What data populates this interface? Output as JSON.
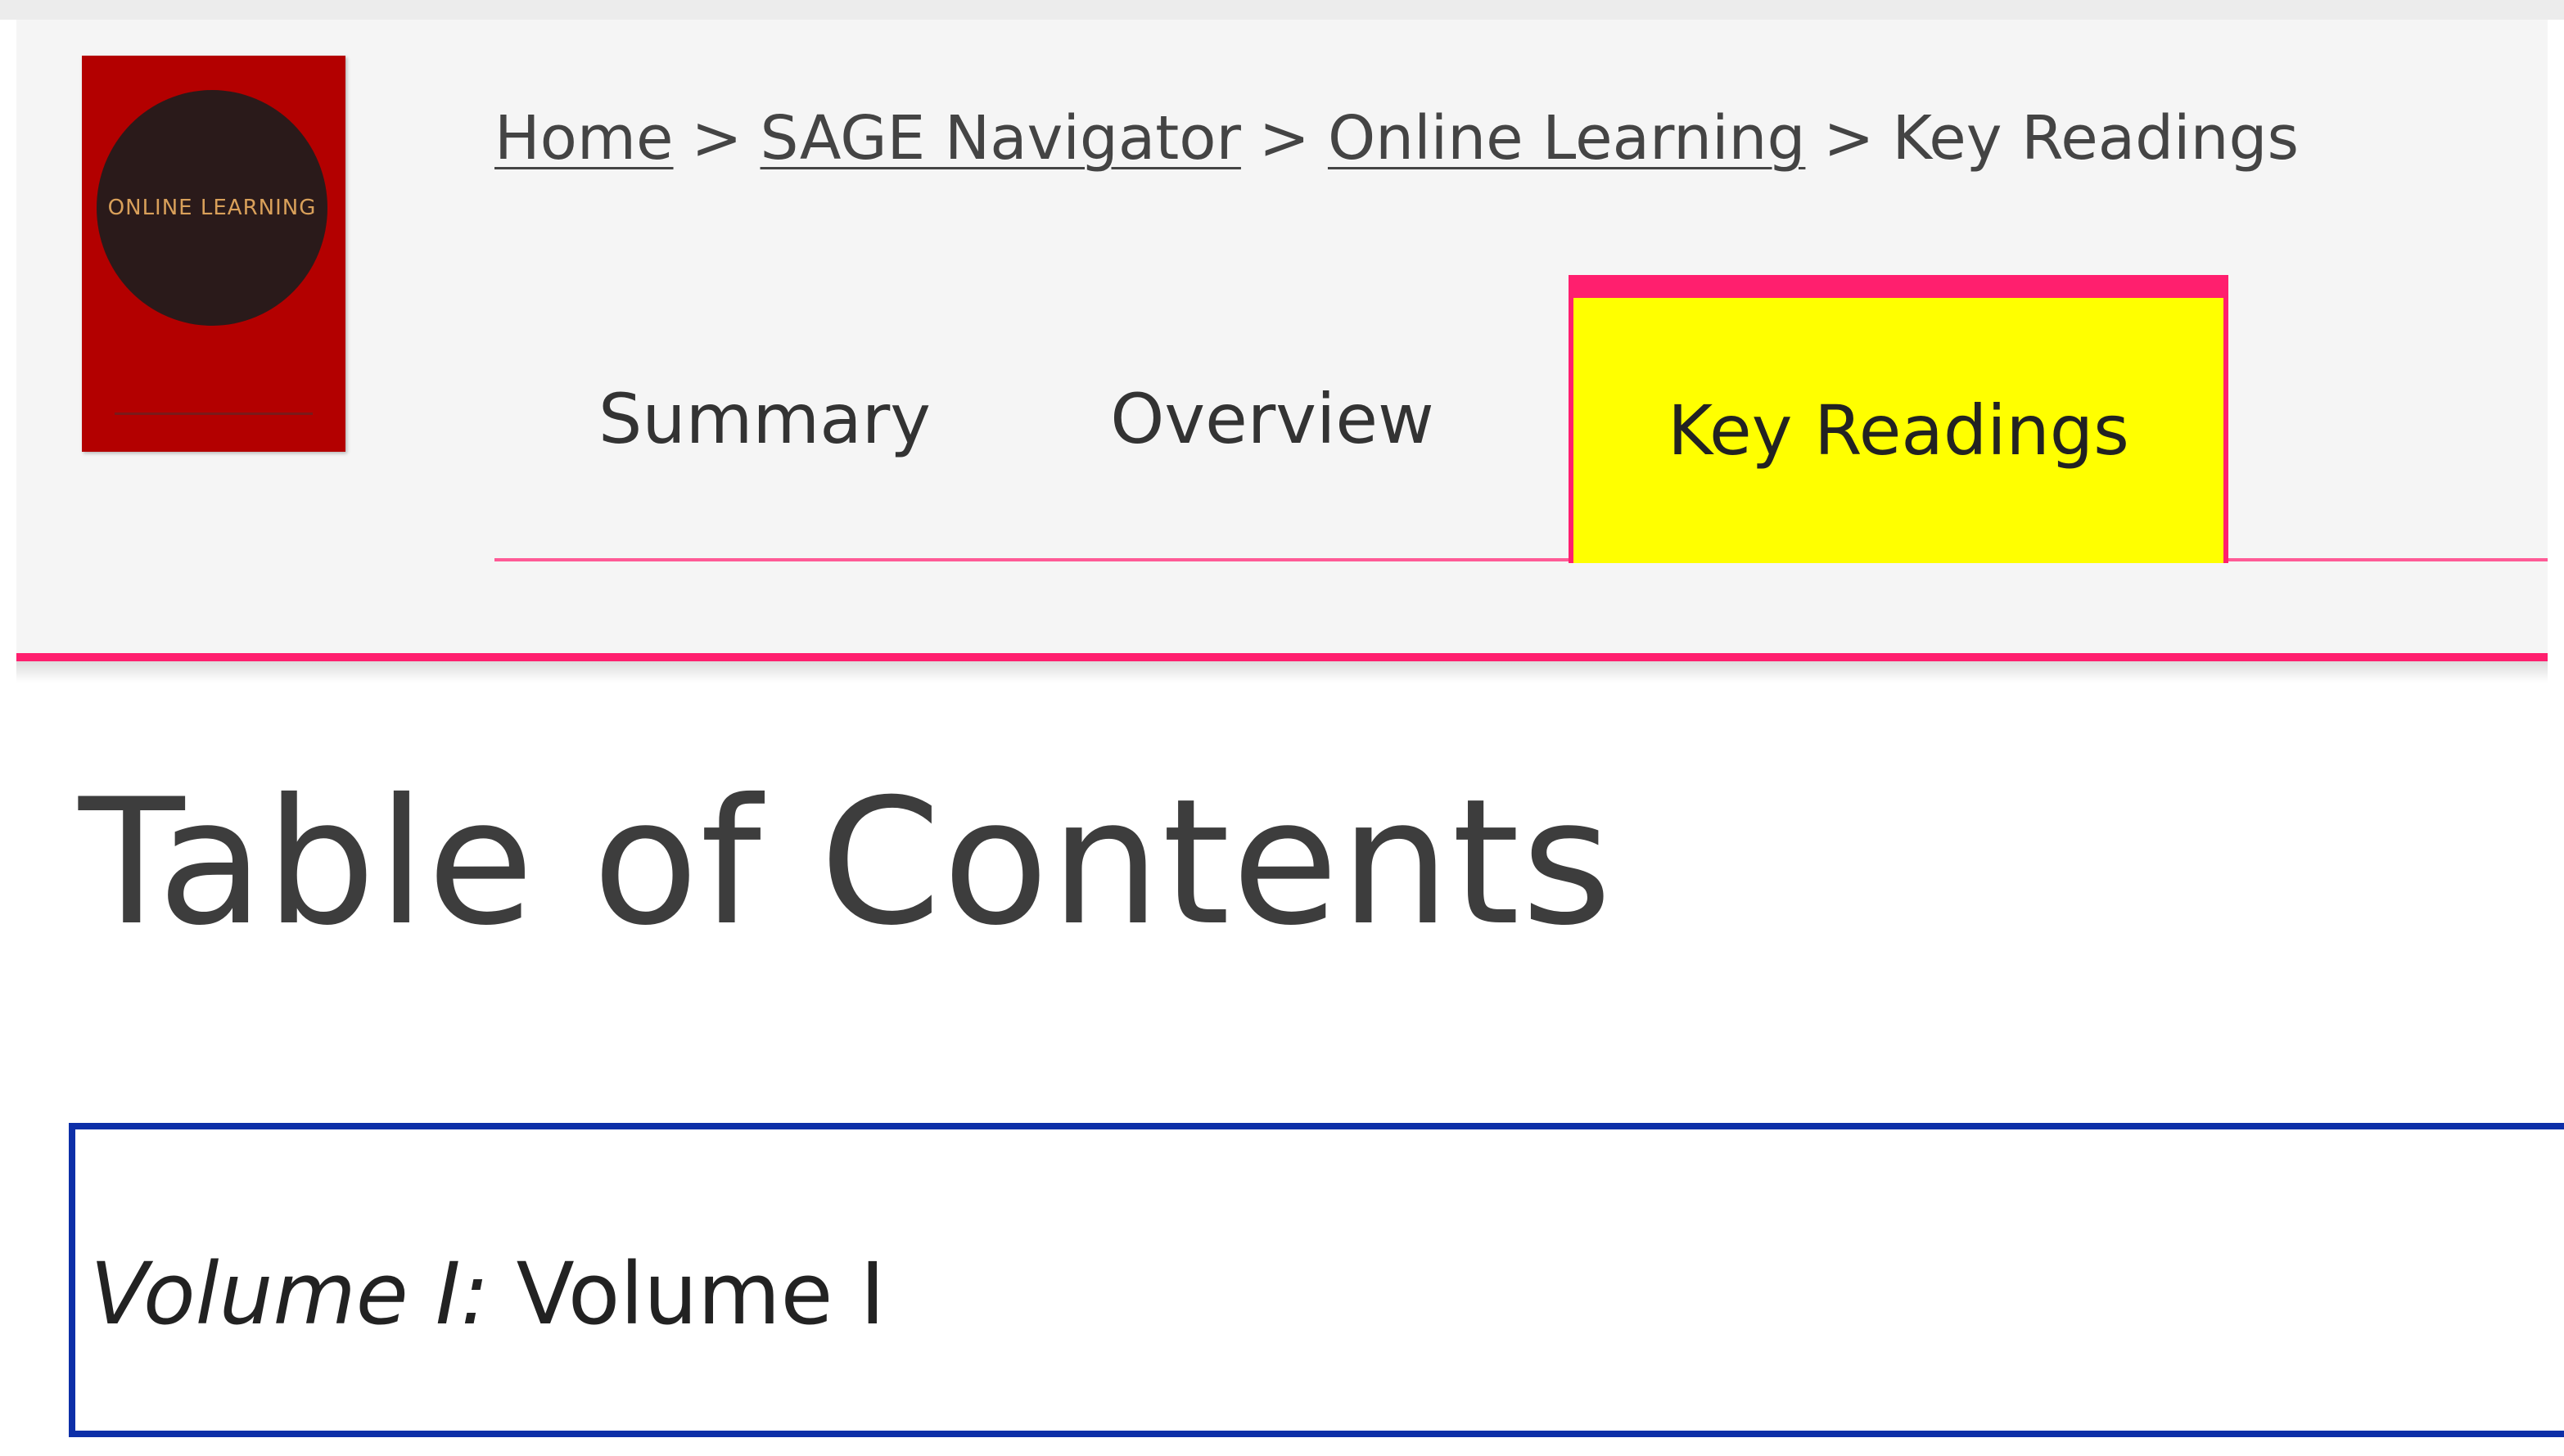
{
  "colors": {
    "accent": "#ff1f6e",
    "active_tab_bg": "#ffff00",
    "box_border": "#0d2fa8",
    "cover_red": "#b30000"
  },
  "book_cover": {
    "title": "ONLINE LEARNING",
    "icon": "book-cover-image"
  },
  "breadcrumb": {
    "items": [
      {
        "label": "Home"
      },
      {
        "label": "SAGE Navigator"
      },
      {
        "label": "Online Learning"
      },
      {
        "label": "Key Readings"
      }
    ],
    "separator": ">"
  },
  "tabs": [
    {
      "label": "Summary",
      "active": false
    },
    {
      "label": "Overview",
      "active": false
    },
    {
      "label": "Key Readings",
      "active": true
    }
  ],
  "main": {
    "title": "Table of Contents",
    "volumes": [
      {
        "label": "Volume I:",
        "name": "Volume I"
      }
    ]
  }
}
